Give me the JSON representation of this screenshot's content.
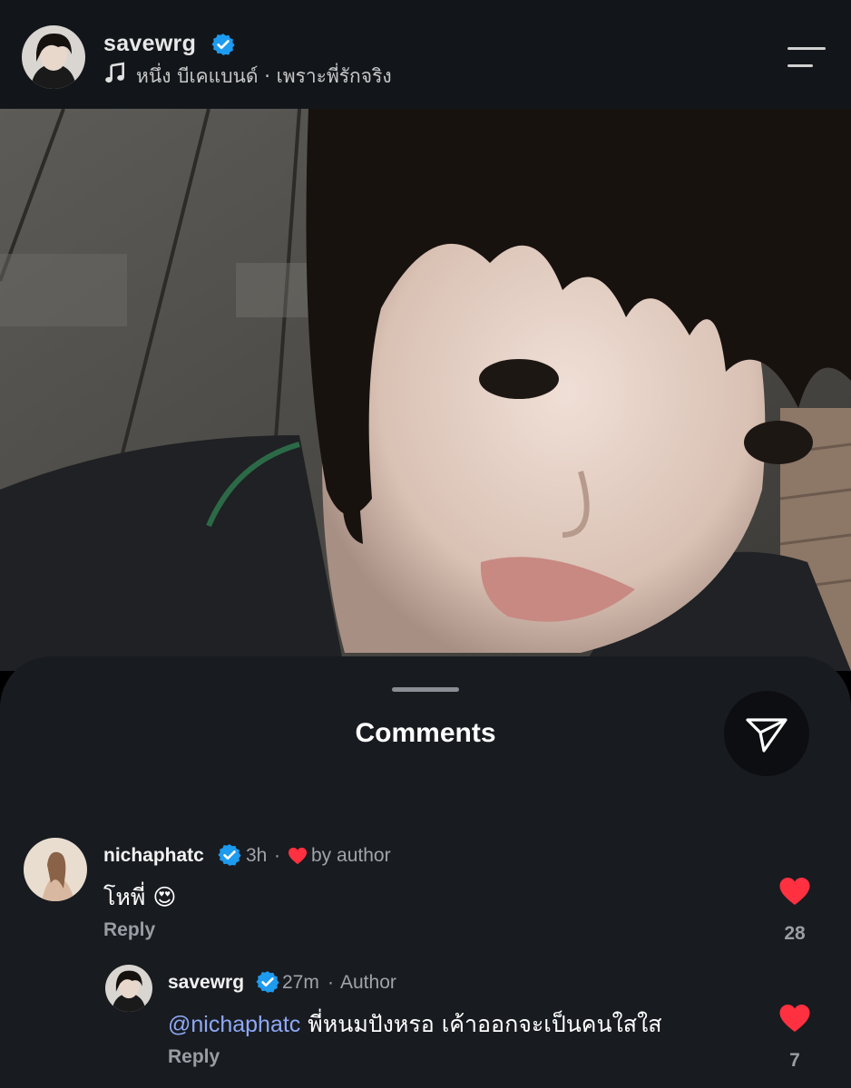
{
  "header": {
    "username": "savewrg",
    "music": "หนึ่ง บีเคแบนด์ · เพราะพี่รักจริง",
    "icons": {
      "verified": "verified-badge-icon",
      "music": "music-note-icon",
      "menu": "menu-icon"
    }
  },
  "comments_sheet": {
    "title": "Comments",
    "share_icon": "send-icon"
  },
  "comments": [
    {
      "username": "nichaphatc",
      "time": "3h",
      "meta": "by author",
      "text": "โหพี่",
      "emoji": "😍",
      "reply_label": "Reply",
      "likes": "28"
    },
    {
      "username": "savewrg",
      "time": "27m",
      "meta": "Author",
      "mention": "@nichaphatc",
      "text": "พี่หนมปังหรอ เค้าออกจะเป็นคนใสใส",
      "reply_label": "Reply",
      "likes": "7"
    }
  ],
  "colors": {
    "verified": "#1d9bf0",
    "heart": "#ff3040",
    "mention": "#8ea8f6",
    "sheet_bg": "#181b20",
    "header_bg": "#12161a"
  }
}
